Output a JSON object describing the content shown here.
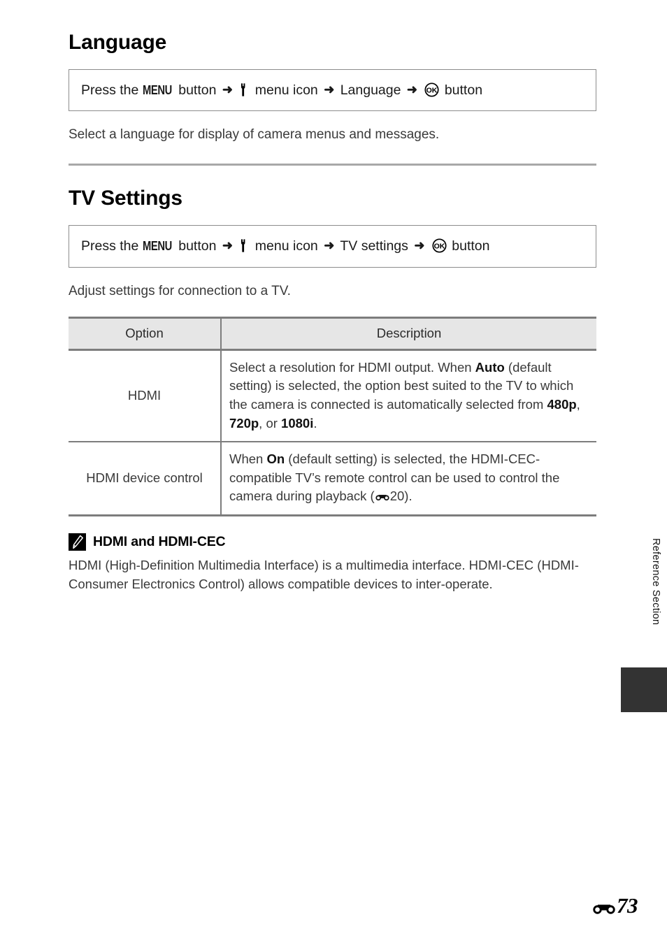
{
  "document": {
    "page_number": "73",
    "page_prefix_icon": "reference-section-icon",
    "side_tab_label": "Reference Section"
  },
  "sections": [
    {
      "title": "Language",
      "nav": {
        "press_the": "Press the",
        "menu_label": "MENU",
        "button_word_1": "button",
        "arrow": "➜",
        "menu_icon_name": "setup-menu-wrench-icon",
        "menu_icon_text": "menu icon",
        "target": "Language",
        "ok_icon_name": "ok-button-icon",
        "ok_icon_text": "OK",
        "button_word_2": "button"
      },
      "description": "Select a language for display of camera menus and messages."
    },
    {
      "title": "TV Settings",
      "nav": {
        "press_the": "Press the",
        "menu_label": "MENU",
        "button_word_1": "button",
        "arrow": "➜",
        "menu_icon_name": "setup-menu-wrench-icon",
        "menu_icon_text": "menu icon",
        "target": "TV settings",
        "ok_icon_name": "ok-button-icon",
        "ok_icon_text": "OK",
        "button_word_2": "button"
      },
      "description": "Adjust settings for connection to a TV."
    }
  ],
  "table": {
    "headers": {
      "option": "Option",
      "description": "Description"
    },
    "rows": [
      {
        "option": "HDMI",
        "description_parts": [
          {
            "text": "Select a resolution for HDMI output. When ",
            "bold": false
          },
          {
            "text": "Auto",
            "bold": true
          },
          {
            "text": " (default setting) is selected, the option best suited to the TV to which the camera is connected is automatically selected from ",
            "bold": false
          },
          {
            "text": "480p",
            "bold": true
          },
          {
            "text": ", ",
            "bold": false
          },
          {
            "text": "720p",
            "bold": true
          },
          {
            "text": ", or ",
            "bold": false
          },
          {
            "text": "1080i",
            "bold": true
          },
          {
            "text": ".",
            "bold": false
          }
        ]
      },
      {
        "option": "HDMI device control",
        "description_parts": [
          {
            "text": "When ",
            "bold": false
          },
          {
            "text": "On",
            "bold": true
          },
          {
            "text": " (default setting) is selected, the HDMI-CEC-compatible TV’s remote control can be used to control the camera during playback (",
            "bold": false
          },
          {
            "text": "REF_ICON",
            "bold": false,
            "icon": "reference-section-icon"
          },
          {
            "text": "20).",
            "bold": false
          }
        ]
      }
    ]
  },
  "note": {
    "icon_name": "pencil-note-icon",
    "title": "HDMI and HDMI-CEC",
    "body": "HDMI (High-Definition Multimedia Interface) is a multimedia interface. HDMI-CEC (HDMI-Consumer Electronics Control) allows compatible devices to inter-operate."
  },
  "colors": {
    "rule": "#a8a8a8",
    "table_border": "#7d7d7d",
    "table_header_bg": "#e6e6e6",
    "side_tab_block": "#333333",
    "body_text": "#3a3a3a"
  }
}
